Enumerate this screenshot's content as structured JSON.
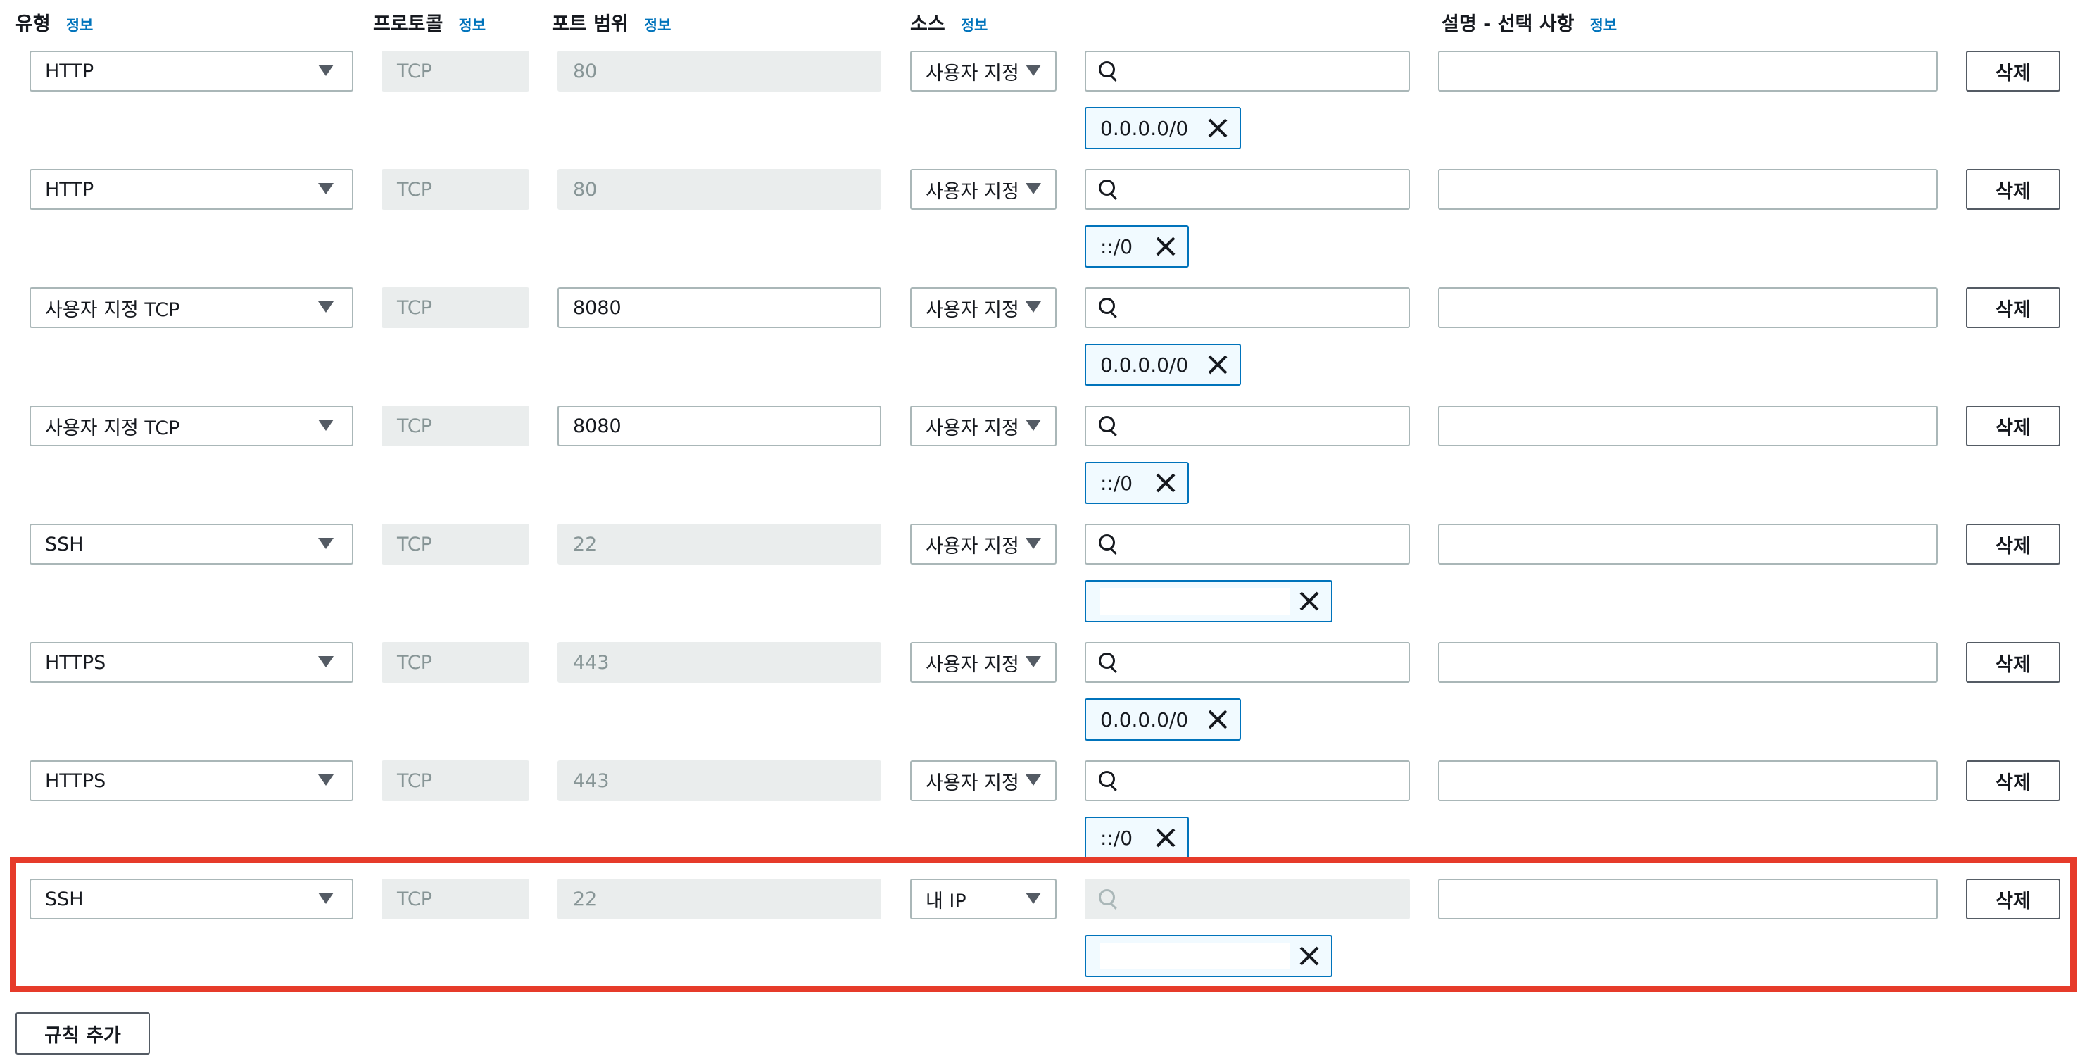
{
  "headers": {
    "type": "유형",
    "protocol": "프로토콜",
    "port_range": "포트 범위",
    "source": "소스",
    "description": "설명 - 선택 사항",
    "info": "정보"
  },
  "rules": [
    {
      "type": "HTTP",
      "protocol": "TCP",
      "port": "80",
      "source": "사용자 지정",
      "cidr": "0.0.0.0/0",
      "delete": "삭제"
    },
    {
      "type": "HTTP",
      "protocol": "TCP",
      "port": "80",
      "source": "사용자 지정",
      "cidr": "::/0",
      "delete": "삭제"
    },
    {
      "type": "사용자 지정 TCP",
      "protocol": "TCP",
      "port": "8080",
      "source": "사용자 지정",
      "cidr": "0.0.0.0/0",
      "delete": "삭제"
    },
    {
      "type": "사용자 지정 TCP",
      "protocol": "TCP",
      "port": "8080",
      "source": "사용자 지정",
      "cidr": "::/0",
      "delete": "삭제"
    },
    {
      "type": "SSH",
      "protocol": "TCP",
      "port": "22",
      "source": "사용자 지정",
      "cidr": "",
      "delete": "삭제"
    },
    {
      "type": "HTTPS",
      "protocol": "TCP",
      "port": "443",
      "source": "사용자 지정",
      "cidr": "0.0.0.0/0",
      "delete": "삭제"
    },
    {
      "type": "HTTPS",
      "protocol": "TCP",
      "port": "443",
      "source": "사용자 지정",
      "cidr": "::/0",
      "delete": "삭제"
    },
    {
      "type": "SSH",
      "protocol": "TCP",
      "port": "22",
      "source": "내 IP",
      "cidr": "",
      "delete": "삭제"
    }
  ],
  "add_rule_label": "규칙 추가",
  "colors": {
    "highlight_border": "#e63b2a",
    "info_link": "#0073bb",
    "token_border": "#0073bb",
    "token_bg": "#f1faff",
    "disabled_bg": "#eaeded"
  }
}
